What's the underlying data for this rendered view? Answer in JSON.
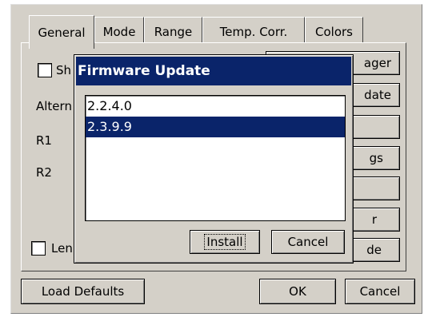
{
  "tabs": [
    {
      "label": "General",
      "active": true
    },
    {
      "label": "Mode",
      "active": false
    },
    {
      "label": "Range",
      "active": false
    },
    {
      "label": "Temp. Corr.",
      "active": false
    },
    {
      "label": "Colors",
      "active": false
    }
  ],
  "general": {
    "checkbox1_label": "Sh",
    "alternate_label": "Altern",
    "r1_label": "R1",
    "r2_label": "R2",
    "checkbox2_label": "Len"
  },
  "side_buttons": [
    "ager",
    "date",
    "",
    "gs",
    "",
    "r",
    "de"
  ],
  "footer": {
    "load_defaults": "Load Defaults",
    "ok": "OK",
    "cancel": "Cancel"
  },
  "dialog": {
    "title": "Firmware Update",
    "versions": [
      "2.2.4.0",
      "2.3.9.9"
    ],
    "selected_index": 1,
    "install": "Install",
    "cancel": "Cancel"
  },
  "colors": {
    "title_bar": "#0a246a",
    "selection": "#0a246a",
    "face": "#d4d0c8"
  }
}
